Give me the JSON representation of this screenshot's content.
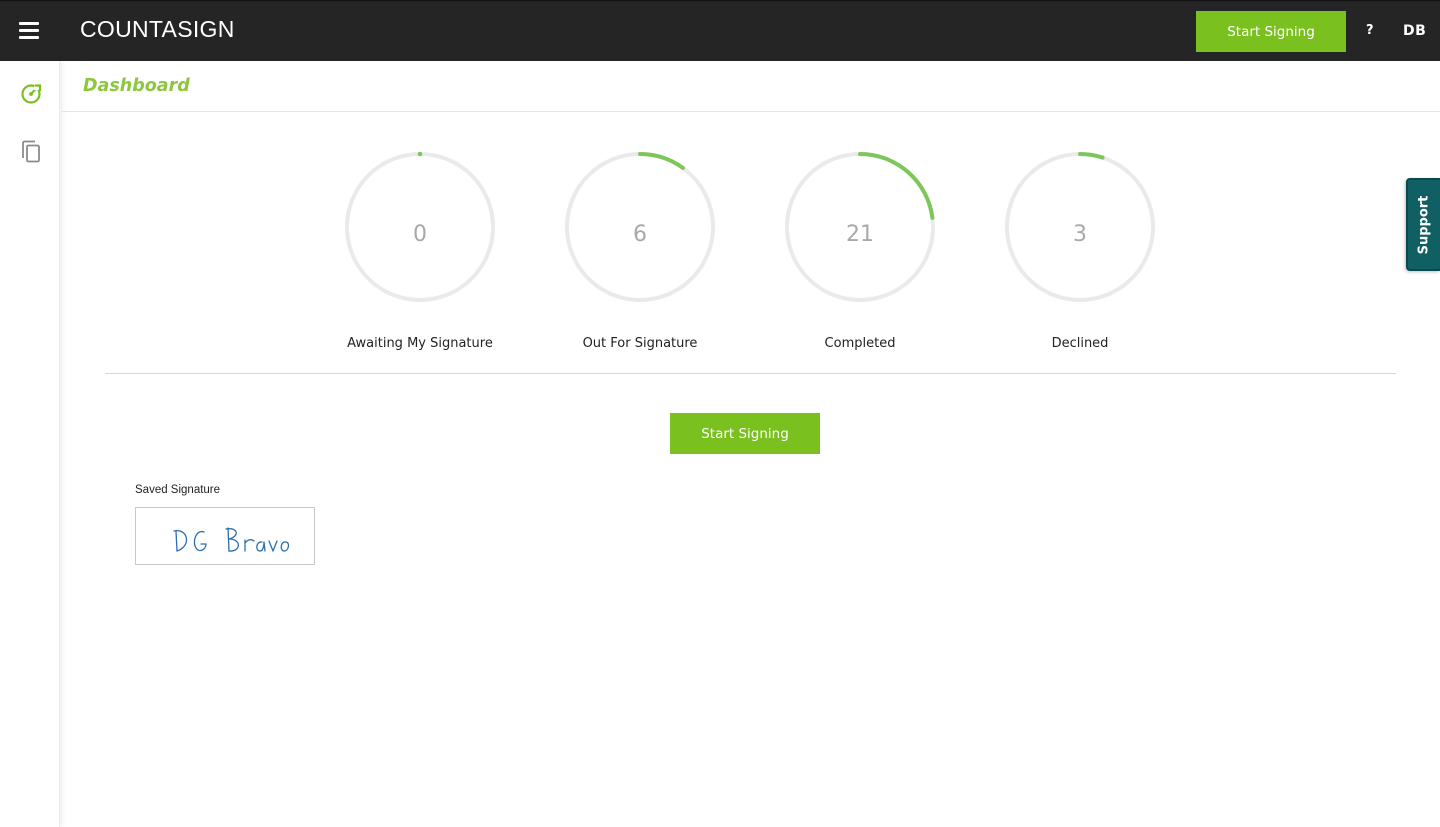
{
  "header": {
    "logo_text": "COUNTASIGN",
    "start_signing_label": "Start Signing",
    "help_label": "?",
    "user_initials": "DB"
  },
  "sidebar": {
    "items": [
      {
        "icon": "dashboard-gauge-icon",
        "active": true
      },
      {
        "icon": "documents-copy-icon",
        "active": false
      }
    ]
  },
  "page": {
    "title": "Dashboard"
  },
  "stats": [
    {
      "value": "0",
      "label": "Awaiting My Signature",
      "progress": 0.0
    },
    {
      "value": "6",
      "label": "Out For Signature",
      "progress": 0.1
    },
    {
      "value": "21",
      "label": "Completed",
      "progress": 0.23
    },
    {
      "value": "3",
      "label": "Declined",
      "progress": 0.05
    }
  ],
  "main": {
    "start_signing_label": "Start Signing",
    "saved_signature_label": "Saved Signature",
    "saved_signature_text": "DG Bravo"
  },
  "support": {
    "label": "Support"
  },
  "colors": {
    "accent_green": "#7ac11f",
    "title_green": "#8dc63f",
    "progress_green": "#7dc75a",
    "topbar": "#252525",
    "support_teal": "#0f5f63",
    "signature_ink": "#2a6fb0"
  }
}
